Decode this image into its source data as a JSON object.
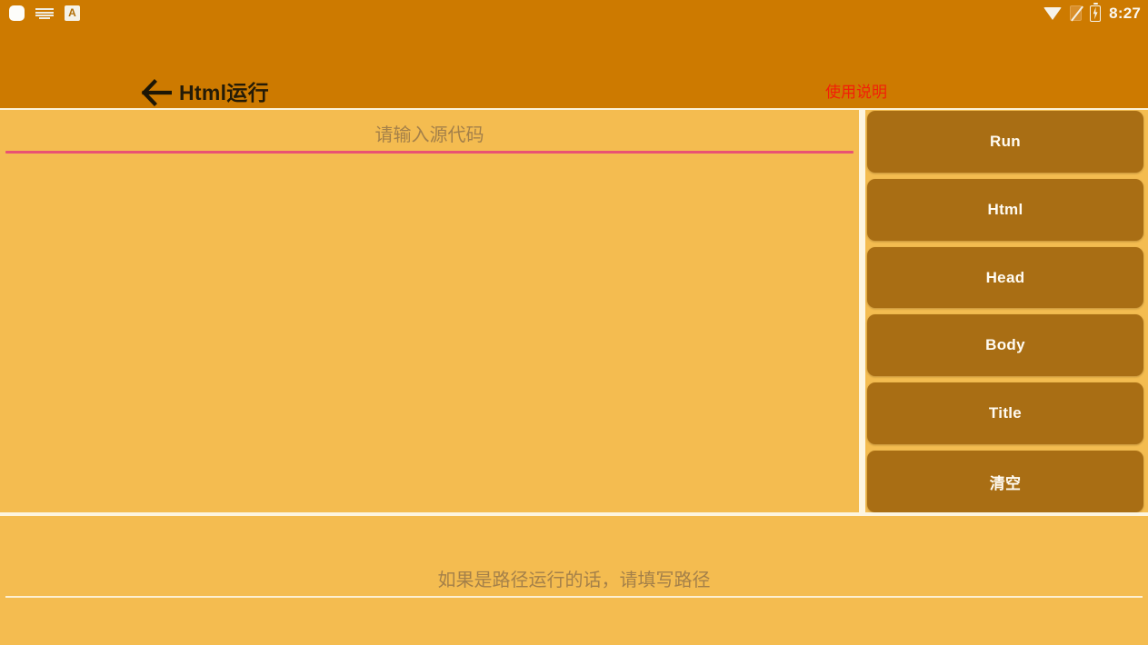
{
  "statusbar": {
    "icons_left": [
      "blank-app-icon",
      "keyboard-icon",
      "a-mark-icon"
    ],
    "icons_right": [
      "wifi-icon",
      "sim-off-icon",
      "battery-charging-icon"
    ],
    "time": "8:27",
    "bg_color": "#cd7a00"
  },
  "header": {
    "back_icon": "back-arrow-icon",
    "title": "Html运行",
    "help_label": "使用说明",
    "help_color": "#f21f08",
    "bg_color": "#cd7a00"
  },
  "editor": {
    "placeholder": "请输入源代码",
    "value": "",
    "underline_color": "#e95273"
  },
  "buttons": [
    {
      "label": "Run",
      "name": "run-button"
    },
    {
      "label": "Html",
      "name": "html-button"
    },
    {
      "label": "Head",
      "name": "head-button"
    },
    {
      "label": "Body",
      "name": "body-button"
    },
    {
      "label": "Title",
      "name": "title-button"
    },
    {
      "label": "清空",
      "name": "clear-button"
    }
  ],
  "path": {
    "placeholder": "如果是路径运行的话，请填写路径",
    "value": ""
  },
  "theme": {
    "page_bg": "#f4bc50",
    "button_bg": "#a96e14",
    "divider": "#fdf5e0",
    "hint_text": "#a48049"
  }
}
